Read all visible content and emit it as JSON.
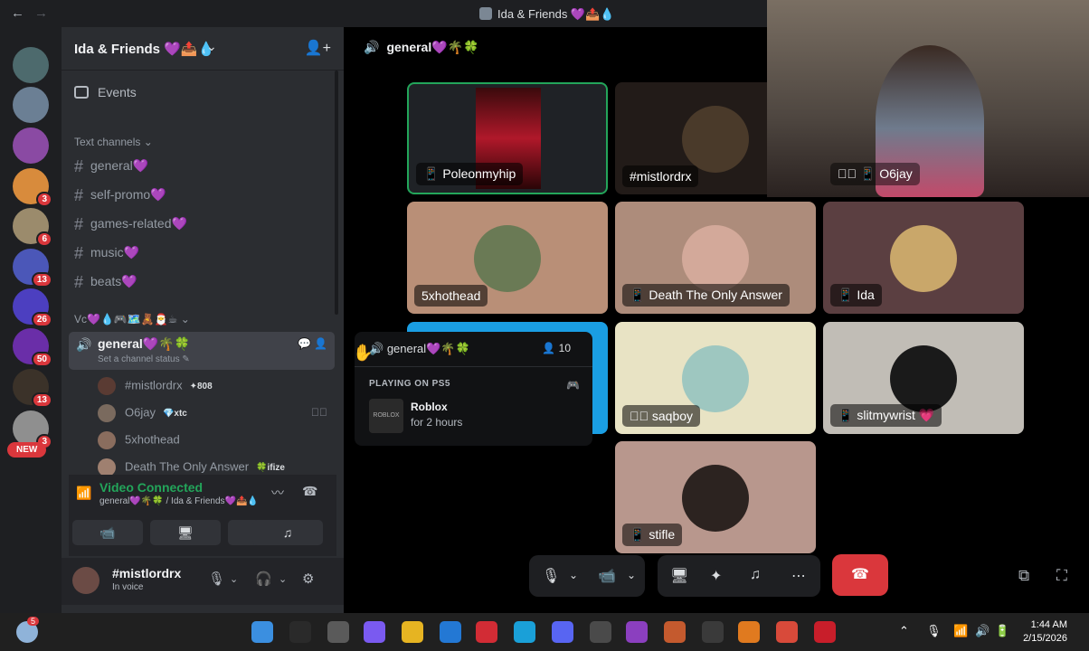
{
  "window": {
    "title": "Ida & Friends 💜📤💧",
    "back": "←",
    "forward": "→"
  },
  "server_rail": {
    "badges": [
      "3",
      "6",
      "13",
      "26",
      "50",
      "13",
      "3"
    ],
    "new_label": "NEW"
  },
  "sidebar": {
    "server_name": "Ida & Friends 💜📤💧",
    "events_label": "Events",
    "text_category": "Text channels ⌄",
    "text_channels": [
      "general💜",
      "self-promo💜",
      "games-related💜",
      "music💜",
      "beats💜"
    ],
    "voice_category": "Vc💜💧🎮🗺️🧸🎅☕ ⌄",
    "active_voice": {
      "name": "general💜🌴🍀",
      "status": "Set a channel status ✎"
    },
    "members": [
      {
        "name": "#mistlordrx",
        "tag": "✦808"
      },
      {
        "name": "O6jay",
        "tag": "💎xtc"
      },
      {
        "name": "5xhothead",
        "tag": ""
      },
      {
        "name": "Death The Only Answer",
        "tag": "🍀ifize"
      }
    ]
  },
  "voice_panel": {
    "title": "Video Connected",
    "subtitle": "general💜🌴🍀 / Ida & Friends💜📤💧"
  },
  "user_panel": {
    "username": "#mistlordrx",
    "status": "In voice"
  },
  "main": {
    "channel_header": "general💜🌴🍀",
    "tiles": [
      {
        "label": "Poleonmyhip",
        "color": "#1f2226"
      },
      {
        "label": "#mistlordrx",
        "color": "#221b18"
      },
      {
        "label": "O6jay",
        "color": "#2a2a2a"
      },
      {
        "label": "5xhothead",
        "color": "#b98f77"
      },
      {
        "label": "Death The Only Answer",
        "color": "#ad8c7b"
      },
      {
        "label": "Ida",
        "color": "#5b3f41"
      },
      {
        "label": "",
        "color": "#1a9ee3"
      },
      {
        "label": "saqboy",
        "color": "#e8e3c4"
      },
      {
        "label": "slitmywrist 💗",
        "color": "#c1bdb6"
      },
      {
        "label": "stifle",
        "color": "#b8978d"
      }
    ]
  },
  "popup": {
    "channel": "general💜🌴🍀",
    "count": "10",
    "heading": "PLAYING ON PS5",
    "game": "Roblox",
    "duration": "for 2 hours",
    "game_img": "ROBLOX"
  },
  "taskbar": {
    "time": "1:44 AM",
    "date": "2/15/2026",
    "notif_badge": "5"
  },
  "colors": {
    "accent_green": "#23a55a",
    "danger": "#da373c",
    "blurple": "#5865f2"
  }
}
